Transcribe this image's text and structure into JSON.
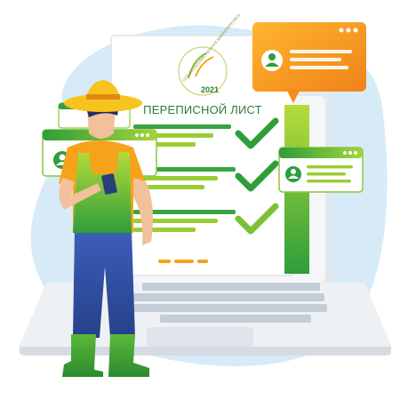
{
  "form": {
    "title": "ПЕРЕПИСНОЙ ЛИСТ",
    "logo_year": "2021",
    "logo_ring_text": "СЕЛЬСКОХОЗЯЙСТВЕННАЯ МИКРОПЕРЕПИСЬ"
  },
  "colors": {
    "blob": "#d6ebf7",
    "green_dark": "#2e9e3a",
    "green_light": "#9acd32",
    "orange": "#f6a21a",
    "denim": "#2f4fa3",
    "laptop": "#eef1f4"
  },
  "icons": [
    "user-avatar-icon",
    "checkmark-icon",
    "window-dots-icon",
    "smartphone-icon"
  ]
}
